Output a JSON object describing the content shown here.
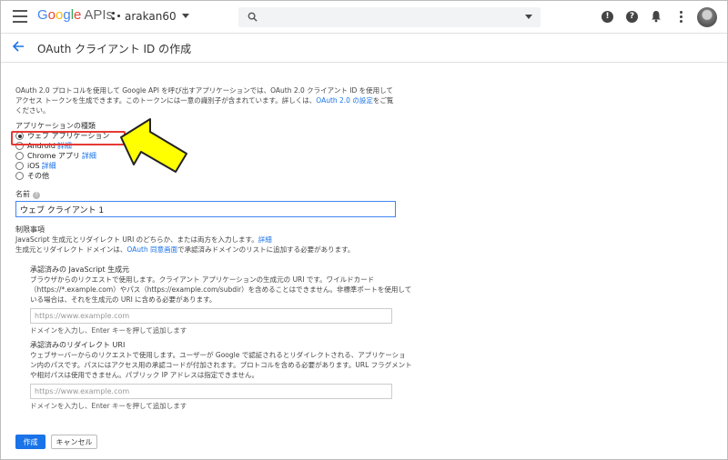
{
  "header": {
    "logo_google": [
      "G",
      "o",
      "o",
      "g",
      "l",
      "e"
    ],
    "logo_apis": "APIs",
    "project_name": "arakan60",
    "icons": [
      "menu-icon",
      "project-icon",
      "search-icon",
      "alert-icon",
      "help-icon",
      "notifications-icon",
      "more-vert-icon",
      "avatar"
    ]
  },
  "page": {
    "title": "OAuth クライアント ID の作成",
    "intro_text": "OAuth 2.0 プロトコルを使用して Google API を呼び出すアプリケーションでは、OAuth 2.0 クライアント ID を使用してアクセス トークンを生成できます。このトークンには一意の識別子が含まれています。詳しくは、",
    "intro_link": "OAuth 2.0 の設定",
    "intro_tail": "をご覧ください。"
  },
  "app_type": {
    "label": "アプリケーションの種類",
    "detail_label": "詳細",
    "options": [
      {
        "label": "ウェブ アプリケーション",
        "selected": true
      },
      {
        "label": "Android",
        "selected": false
      },
      {
        "label": "Chrome アプリ",
        "selected": false
      },
      {
        "label": "iOS",
        "selected": false
      },
      {
        "label": "その他",
        "selected": false
      }
    ]
  },
  "name_field": {
    "label": "名前",
    "value": "ウェブ クライアント 1"
  },
  "restrictions": {
    "title": "制限事項",
    "line1": "JavaScript 生成元とリダイレクト URI のどちらか、または両方を入力します。",
    "line1_link": "詳細",
    "line2_a": "生成元とリダイレクト ドメインは、",
    "line2_link": "OAuth 同意画面",
    "line2_b": "で承認済みドメインのリストに追加する必要があります。",
    "js_origins": {
      "title": "承認済みの JavaScript 生成元",
      "desc": "ブラウザからのリクエストで使用します。クライアント アプリケーションの生成元の URI です。ワイルドカード（https://*.example.com）やパス（https://example.com/subdir）を含めることはできません。非標準ポートを使用している場合は、それを生成元の URI に含める必要があります。",
      "placeholder": "https://www.example.com",
      "hint": "ドメインを入力し、Enter キーを押して追加します"
    },
    "redirect_uris": {
      "title": "承認済みのリダイレクト URI",
      "desc": "ウェブサーバーからのリクエストで使用します。ユーザーが Google で認証されるとリダイレクトされる、アプリケーション内のパスです。パスにはアクセス用の承認コードが付加されます。プロトコルを含める必要があります。URL フラグメントや相対パスは使用できません。パブリック IP アドレスは指定できません。",
      "placeholder": "https://www.example.com",
      "hint": "ドメインを入力し、Enter キーを押して追加します"
    }
  },
  "actions": {
    "create": "作成",
    "cancel": "キャンセル"
  },
  "colors": {
    "accent": "#1a73e8",
    "annotation_arrow": "#ffff00",
    "highlight_box": "#e53935"
  }
}
